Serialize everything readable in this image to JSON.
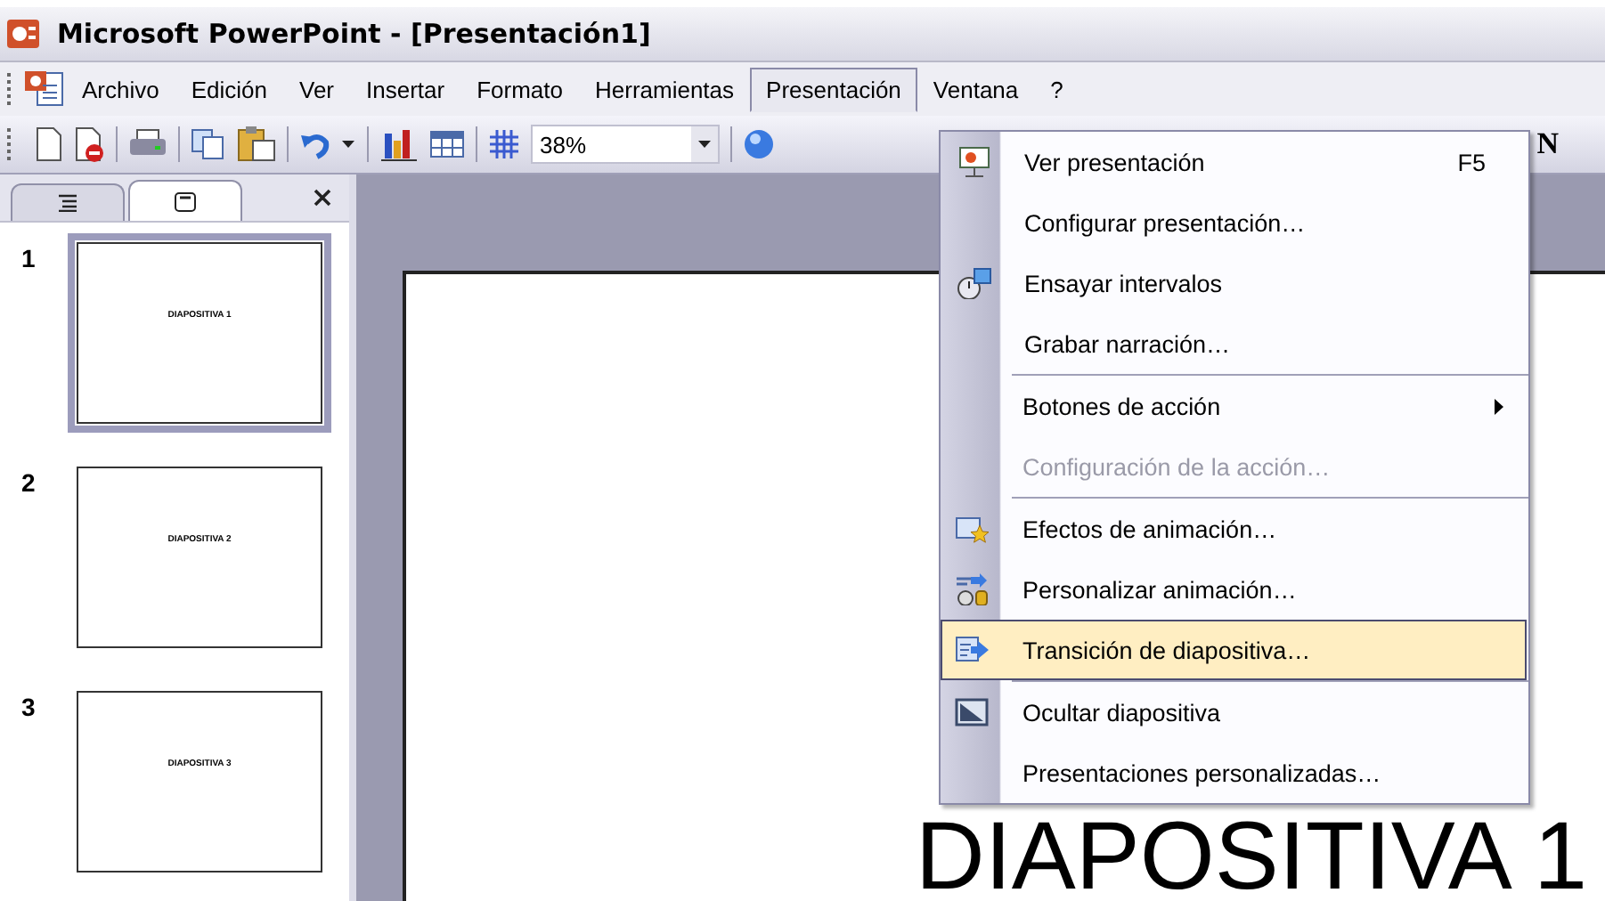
{
  "window": {
    "title": "Microsoft PowerPoint - [Presentación1]"
  },
  "menu_bar": [
    {
      "label": "Archivo",
      "selected": false
    },
    {
      "label": "Edición",
      "selected": false
    },
    {
      "label": "Ver",
      "selected": false
    },
    {
      "label": "Insertar",
      "selected": false
    },
    {
      "label": "Formato",
      "selected": false
    },
    {
      "label": "Herramientas",
      "selected": false
    },
    {
      "label": "Presentación",
      "selected": true
    },
    {
      "label": "Ventana",
      "selected": false
    },
    {
      "label": "?",
      "selected": false
    }
  ],
  "toolbar": {
    "zoom": "38%",
    "format_buttons": [
      "N"
    ]
  },
  "pane_tabs": [
    {
      "kind": "outline",
      "selected": false
    },
    {
      "kind": "slides",
      "selected": true
    }
  ],
  "slides": [
    {
      "number": "1",
      "title": "DIAPOSITIVA 1",
      "selected": true
    },
    {
      "number": "2",
      "title": "DIAPOSITIVA 2",
      "selected": false
    },
    {
      "number": "3",
      "title": "DIAPOSITIVA 3",
      "selected": false
    }
  ],
  "slide": {
    "title": "DIAPOSITIVA 1"
  },
  "menu": {
    "groups": [
      [
        {
          "label": "Ver presentación",
          "shortcut": "F5",
          "disabled": false,
          "selected": false,
          "submenu": false
        },
        {
          "label": "Configurar presentación…",
          "disabled": false,
          "selected": false,
          "submenu": false
        },
        {
          "label": "Ensayar intervalos",
          "disabled": false,
          "selected": false,
          "submenu": false
        },
        {
          "label": "Grabar narración…",
          "disabled": false,
          "selected": false,
          "submenu": false
        }
      ],
      [
        {
          "label": "Botones de acción",
          "disabled": false,
          "selected": false,
          "submenu": true
        },
        {
          "label": "Configuración de la acción…",
          "disabled": true,
          "selected": false,
          "submenu": false
        }
      ],
      [
        {
          "label": "Efectos de animación…",
          "disabled": false,
          "selected": false,
          "submenu": false
        },
        {
          "label": "Personalizar animación…",
          "disabled": false,
          "selected": false,
          "submenu": false
        },
        {
          "label": "Transición de diapositiva…",
          "disabled": false,
          "selected": true,
          "submenu": false
        }
      ],
      [
        {
          "label": "Ocultar diapositiva",
          "disabled": false,
          "selected": false,
          "submenu": false
        },
        {
          "label": "Presentaciones personalizadas…",
          "disabled": false,
          "selected": false,
          "submenu": false
        }
      ]
    ]
  }
}
